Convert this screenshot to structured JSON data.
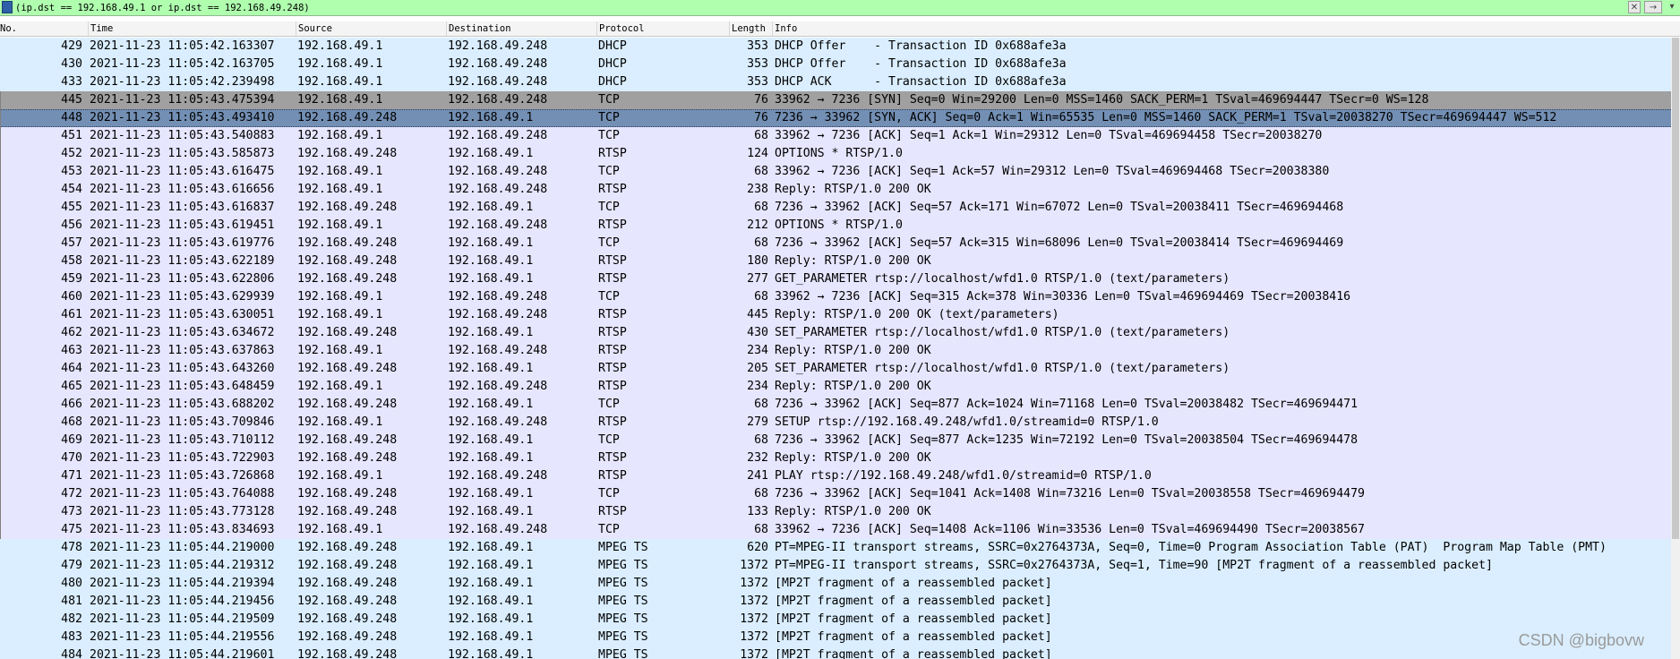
{
  "filter": {
    "expression": "(ip.dst == 192.168.49.1 or ip.dst == 192.168.49.248)",
    "clear_icon": "close-icon",
    "apply_icon": "arrow-right-icon",
    "dropdown_icon": "chevron-down-icon"
  },
  "columns": [
    "No.",
    "Time",
    "Source",
    "Destination",
    "Protocol",
    "Length",
    "Info"
  ],
  "colors": {
    "dhcp": "#daeeff",
    "tcp": "#e7e6ff",
    "rtsp": "#e7e6ff",
    "mpeg": "#daeeff",
    "syn": "#a0a0a0",
    "selected": "#738fb4"
  },
  "packets": [
    {
      "no": "429",
      "time": "2021-11-23 11:05:42.163307",
      "src": "192.168.49.1",
      "dst": "192.168.49.248",
      "proto": "DHCP",
      "len": "353",
      "info": "DHCP Offer    - Transaction ID 0x688afe3a",
      "style": "dhcp"
    },
    {
      "no": "430",
      "time": "2021-11-23 11:05:42.163705",
      "src": "192.168.49.1",
      "dst": "192.168.49.248",
      "proto": "DHCP",
      "len": "353",
      "info": "DHCP Offer    - Transaction ID 0x688afe3a",
      "style": "dhcp"
    },
    {
      "no": "433",
      "time": "2021-11-23 11:05:42.239498",
      "src": "192.168.49.1",
      "dst": "192.168.49.248",
      "proto": "DHCP",
      "len": "353",
      "info": "DHCP ACK      - Transaction ID 0x688afe3a",
      "style": "dhcp"
    },
    {
      "no": "445",
      "time": "2021-11-23 11:05:43.475394",
      "src": "192.168.49.1",
      "dst": "192.168.49.248",
      "proto": "TCP",
      "len": "76",
      "info": "33962 → 7236 [SYN] Seq=0 Win=29200 Len=0 MSS=1460 SACK_PERM=1 TSval=469694447 TSecr=0 WS=128",
      "style": "syn"
    },
    {
      "no": "448",
      "time": "2021-11-23 11:05:43.493410",
      "src": "192.168.49.248",
      "dst": "192.168.49.1",
      "proto": "TCP",
      "len": "76",
      "info": "7236 → 33962 [SYN, ACK] Seq=0 Ack=1 Win=65535 Len=0 MSS=1460 SACK_PERM=1 TSval=20038270 TSecr=469694447 WS=512",
      "style": "selected"
    },
    {
      "no": "451",
      "time": "2021-11-23 11:05:43.540883",
      "src": "192.168.49.1",
      "dst": "192.168.49.248",
      "proto": "TCP",
      "len": "68",
      "info": "33962 → 7236 [ACK] Seq=1 Ack=1 Win=29312 Len=0 TSval=469694458 TSecr=20038270",
      "style": "tcp"
    },
    {
      "no": "452",
      "time": "2021-11-23 11:05:43.585873",
      "src": "192.168.49.248",
      "dst": "192.168.49.1",
      "proto": "RTSP",
      "len": "124",
      "info": "OPTIONS * RTSP/1.0",
      "style": "rtsp"
    },
    {
      "no": "453",
      "time": "2021-11-23 11:05:43.616475",
      "src": "192.168.49.1",
      "dst": "192.168.49.248",
      "proto": "TCP",
      "len": "68",
      "info": "33962 → 7236 [ACK] Seq=1 Ack=57 Win=29312 Len=0 TSval=469694468 TSecr=20038380",
      "style": "tcp"
    },
    {
      "no": "454",
      "time": "2021-11-23 11:05:43.616656",
      "src": "192.168.49.1",
      "dst": "192.168.49.248",
      "proto": "RTSP",
      "len": "238",
      "info": "Reply: RTSP/1.0 200 OK",
      "style": "rtsp"
    },
    {
      "no": "455",
      "time": "2021-11-23 11:05:43.616837",
      "src": "192.168.49.248",
      "dst": "192.168.49.1",
      "proto": "TCP",
      "len": "68",
      "info": "7236 → 33962 [ACK] Seq=57 Ack=171 Win=67072 Len=0 TSval=20038411 TSecr=469694468",
      "style": "tcp"
    },
    {
      "no": "456",
      "time": "2021-11-23 11:05:43.619451",
      "src": "192.168.49.1",
      "dst": "192.168.49.248",
      "proto": "RTSP",
      "len": "212",
      "info": "OPTIONS * RTSP/1.0",
      "style": "rtsp"
    },
    {
      "no": "457",
      "time": "2021-11-23 11:05:43.619776",
      "src": "192.168.49.248",
      "dst": "192.168.49.1",
      "proto": "TCP",
      "len": "68",
      "info": "7236 → 33962 [ACK] Seq=57 Ack=315 Win=68096 Len=0 TSval=20038414 TSecr=469694469",
      "style": "tcp"
    },
    {
      "no": "458",
      "time": "2021-11-23 11:05:43.622189",
      "src": "192.168.49.248",
      "dst": "192.168.49.1",
      "proto": "RTSP",
      "len": "180",
      "info": "Reply: RTSP/1.0 200 OK",
      "style": "rtsp"
    },
    {
      "no": "459",
      "time": "2021-11-23 11:05:43.622806",
      "src": "192.168.49.248",
      "dst": "192.168.49.1",
      "proto": "RTSP",
      "len": "277",
      "info": "GET_PARAMETER rtsp://localhost/wfd1.0 RTSP/1.0 (text/parameters)",
      "style": "rtsp"
    },
    {
      "no": "460",
      "time": "2021-11-23 11:05:43.629939",
      "src": "192.168.49.1",
      "dst": "192.168.49.248",
      "proto": "TCP",
      "len": "68",
      "info": "33962 → 7236 [ACK] Seq=315 Ack=378 Win=30336 Len=0 TSval=469694469 TSecr=20038416",
      "style": "tcp"
    },
    {
      "no": "461",
      "time": "2021-11-23 11:05:43.630051",
      "src": "192.168.49.1",
      "dst": "192.168.49.248",
      "proto": "RTSP",
      "len": "445",
      "info": "Reply: RTSP/1.0 200 OK (text/parameters)",
      "style": "rtsp"
    },
    {
      "no": "462",
      "time": "2021-11-23 11:05:43.634672",
      "src": "192.168.49.248",
      "dst": "192.168.49.1",
      "proto": "RTSP",
      "len": "430",
      "info": "SET_PARAMETER rtsp://localhost/wfd1.0 RTSP/1.0 (text/parameters)",
      "style": "rtsp"
    },
    {
      "no": "463",
      "time": "2021-11-23 11:05:43.637863",
      "src": "192.168.49.1",
      "dst": "192.168.49.248",
      "proto": "RTSP",
      "len": "234",
      "info": "Reply: RTSP/1.0 200 OK",
      "style": "rtsp"
    },
    {
      "no": "464",
      "time": "2021-11-23 11:05:43.643260",
      "src": "192.168.49.248",
      "dst": "192.168.49.1",
      "proto": "RTSP",
      "len": "205",
      "info": "SET_PARAMETER rtsp://localhost/wfd1.0 RTSP/1.0 (text/parameters)",
      "style": "rtsp"
    },
    {
      "no": "465",
      "time": "2021-11-23 11:05:43.648459",
      "src": "192.168.49.1",
      "dst": "192.168.49.248",
      "proto": "RTSP",
      "len": "234",
      "info": "Reply: RTSP/1.0 200 OK",
      "style": "rtsp"
    },
    {
      "no": "466",
      "time": "2021-11-23 11:05:43.688202",
      "src": "192.168.49.248",
      "dst": "192.168.49.1",
      "proto": "TCP",
      "len": "68",
      "info": "7236 → 33962 [ACK] Seq=877 Ack=1024 Win=71168 Len=0 TSval=20038482 TSecr=469694471",
      "style": "tcp"
    },
    {
      "no": "468",
      "time": "2021-11-23 11:05:43.709846",
      "src": "192.168.49.1",
      "dst": "192.168.49.248",
      "proto": "RTSP",
      "len": "279",
      "info": "SETUP rtsp://192.168.49.248/wfd1.0/streamid=0 RTSP/1.0",
      "style": "rtsp"
    },
    {
      "no": "469",
      "time": "2021-11-23 11:05:43.710112",
      "src": "192.168.49.248",
      "dst": "192.168.49.1",
      "proto": "TCP",
      "len": "68",
      "info": "7236 → 33962 [ACK] Seq=877 Ack=1235 Win=72192 Len=0 TSval=20038504 TSecr=469694478",
      "style": "tcp"
    },
    {
      "no": "470",
      "time": "2021-11-23 11:05:43.722903",
      "src": "192.168.49.248",
      "dst": "192.168.49.1",
      "proto": "RTSP",
      "len": "232",
      "info": "Reply: RTSP/1.0 200 OK",
      "style": "rtsp"
    },
    {
      "no": "471",
      "time": "2021-11-23 11:05:43.726868",
      "src": "192.168.49.1",
      "dst": "192.168.49.248",
      "proto": "RTSP",
      "len": "241",
      "info": "PLAY rtsp://192.168.49.248/wfd1.0/streamid=0 RTSP/1.0",
      "style": "rtsp"
    },
    {
      "no": "472",
      "time": "2021-11-23 11:05:43.764088",
      "src": "192.168.49.248",
      "dst": "192.168.49.1",
      "proto": "TCP",
      "len": "68",
      "info": "7236 → 33962 [ACK] Seq=1041 Ack=1408 Win=73216 Len=0 TSval=20038558 TSecr=469694479",
      "style": "tcp"
    },
    {
      "no": "473",
      "time": "2021-11-23 11:05:43.773128",
      "src": "192.168.49.248",
      "dst": "192.168.49.1",
      "proto": "RTSP",
      "len": "133",
      "info": "Reply: RTSP/1.0 200 OK",
      "style": "rtsp"
    },
    {
      "no": "475",
      "time": "2021-11-23 11:05:43.834693",
      "src": "192.168.49.1",
      "dst": "192.168.49.248",
      "proto": "TCP",
      "len": "68",
      "info": "33962 → 7236 [ACK] Seq=1408 Ack=1106 Win=33536 Len=0 TSval=469694490 TSecr=20038567",
      "style": "tcp"
    },
    {
      "no": "478",
      "time": "2021-11-23 11:05:44.219000",
      "src": "192.168.49.248",
      "dst": "192.168.49.1",
      "proto": "MPEG TS",
      "len": "620",
      "info": "PT=MPEG-II transport streams, SSRC=0x2764373A, Seq=0, Time=0 Program Association Table (PAT)  Program Map Table (PMT)",
      "style": "mpeg"
    },
    {
      "no": "479",
      "time": "2021-11-23 11:05:44.219312",
      "src": "192.168.49.248",
      "dst": "192.168.49.1",
      "proto": "MPEG TS",
      "len": "1372",
      "info": "PT=MPEG-II transport streams, SSRC=0x2764373A, Seq=1, Time=90 [MP2T fragment of a reassembled packet]",
      "style": "mpeg"
    },
    {
      "no": "480",
      "time": "2021-11-23 11:05:44.219394",
      "src": "192.168.49.248",
      "dst": "192.168.49.1",
      "proto": "MPEG TS",
      "len": "1372",
      "info": "[MP2T fragment of a reassembled packet]",
      "style": "mpeg"
    },
    {
      "no": "481",
      "time": "2021-11-23 11:05:44.219456",
      "src": "192.168.49.248",
      "dst": "192.168.49.1",
      "proto": "MPEG TS",
      "len": "1372",
      "info": "[MP2T fragment of a reassembled packet]",
      "style": "mpeg"
    },
    {
      "no": "482",
      "time": "2021-11-23 11:05:44.219509",
      "src": "192.168.49.248",
      "dst": "192.168.49.1",
      "proto": "MPEG TS",
      "len": "1372",
      "info": "[MP2T fragment of a reassembled packet]",
      "style": "mpeg"
    },
    {
      "no": "483",
      "time": "2021-11-23 11:05:44.219556",
      "src": "192.168.49.248",
      "dst": "192.168.49.1",
      "proto": "MPEG TS",
      "len": "1372",
      "info": "[MP2T fragment of a reassembled packet]",
      "style": "mpeg"
    },
    {
      "no": "484",
      "time": "2021-11-23 11:05:44.219601",
      "src": "192.168.49.248",
      "dst": "192.168.49.1",
      "proto": "MPEG TS",
      "len": "1372",
      "info": "[MP2T fragment of a reassembled packet]",
      "style": "mpeg"
    }
  ],
  "watermark": "CSDN @bigbovw"
}
